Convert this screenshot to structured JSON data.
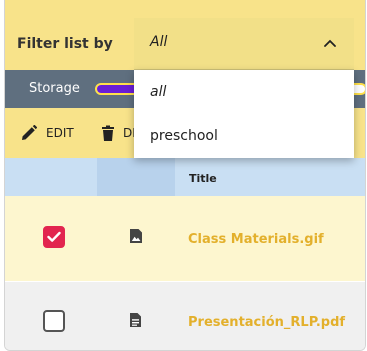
{
  "filter": {
    "label": "Filter list by",
    "selected": "All",
    "options": [
      "all",
      "preschool"
    ]
  },
  "storage": {
    "label": "Storage",
    "used_fraction": 0.2
  },
  "toolbar": {
    "edit_label": "EDIT",
    "delete_label": "DELETE"
  },
  "table": {
    "title_header": "Title",
    "rows": [
      {
        "title": "Class Materials.gif",
        "checked": true,
        "icon": "image-file-icon"
      },
      {
        "title": "Presentación_RLP.pdf",
        "checked": false,
        "icon": "document-file-icon"
      }
    ]
  },
  "colors": {
    "header_yellow": "#f8e38a",
    "storage_bar": "#5f6f7f",
    "storage_fill": "#6a1ed6",
    "table_header": "#c9dff3",
    "title_accent": "#e3b02c",
    "checkbox_checked": "#e2254f"
  }
}
